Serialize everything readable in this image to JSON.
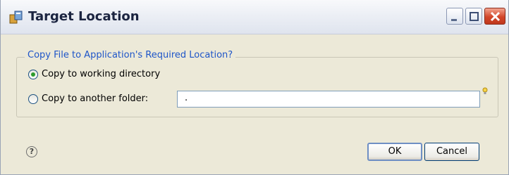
{
  "window": {
    "title": "Target Location"
  },
  "group": {
    "legend": "Copy File to Application's Required Location?",
    "options": [
      {
        "label": "Copy to working directory",
        "selected": true
      },
      {
        "label": "Copy to another folder:",
        "selected": false
      }
    ],
    "folder_value": "."
  },
  "footer": {
    "help": "?",
    "ok_label": "OK",
    "cancel_label": "Cancel"
  },
  "colors": {
    "legend": "#1e55c8",
    "radio_selected": "#2d9b2d",
    "close_button": "#d2462a"
  },
  "icons": [
    "app-icon",
    "minimize-icon",
    "maximize-icon",
    "close-icon",
    "lightbulb-icon",
    "help-icon"
  ]
}
